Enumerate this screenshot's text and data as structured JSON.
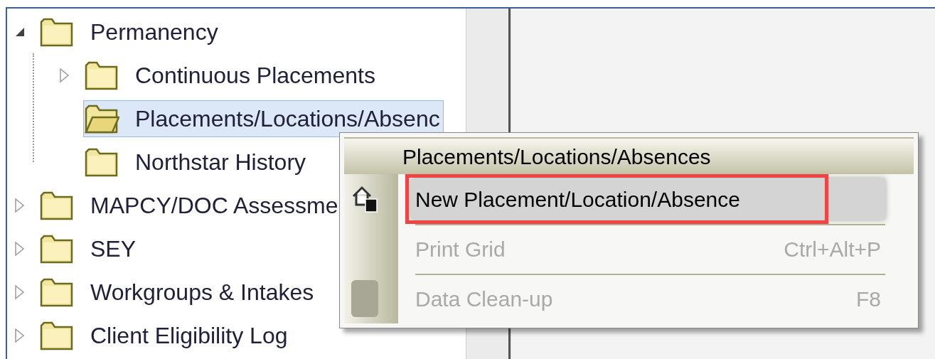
{
  "tree": [
    {
      "label": "Permanency",
      "expanded": true,
      "selected": false,
      "children": [
        {
          "label": "Continuous Placements",
          "expanded": false,
          "selected": false
        },
        {
          "label": "Placements/Locations/Absenc",
          "selected": true
        },
        {
          "label": "Northstar History",
          "selected": false
        }
      ]
    },
    {
      "label": "MAPCY/DOC Assessme",
      "expanded": false,
      "selected": false
    },
    {
      "label": "SEY",
      "expanded": false,
      "selected": false
    },
    {
      "label": "Workgroups & Intakes",
      "expanded": false,
      "selected": false
    },
    {
      "label": "Client Eligibility Log",
      "expanded": false,
      "selected": false
    }
  ],
  "context_menu": {
    "title": "Placements/Locations/Absences",
    "items": [
      {
        "kind": "house",
        "label": "New Placement/Location/Absence",
        "selected": true,
        "disabled": false,
        "annotated": true
      },
      {
        "kind": "plain",
        "label": "Print Grid",
        "shortcut": "Ctrl+Alt+P",
        "selected": false,
        "disabled": true,
        "annotated": false
      },
      {
        "kind": "square",
        "label": "Data Clean-up",
        "shortcut": "F8",
        "selected": false,
        "disabled": true,
        "annotated": false
      }
    ]
  }
}
